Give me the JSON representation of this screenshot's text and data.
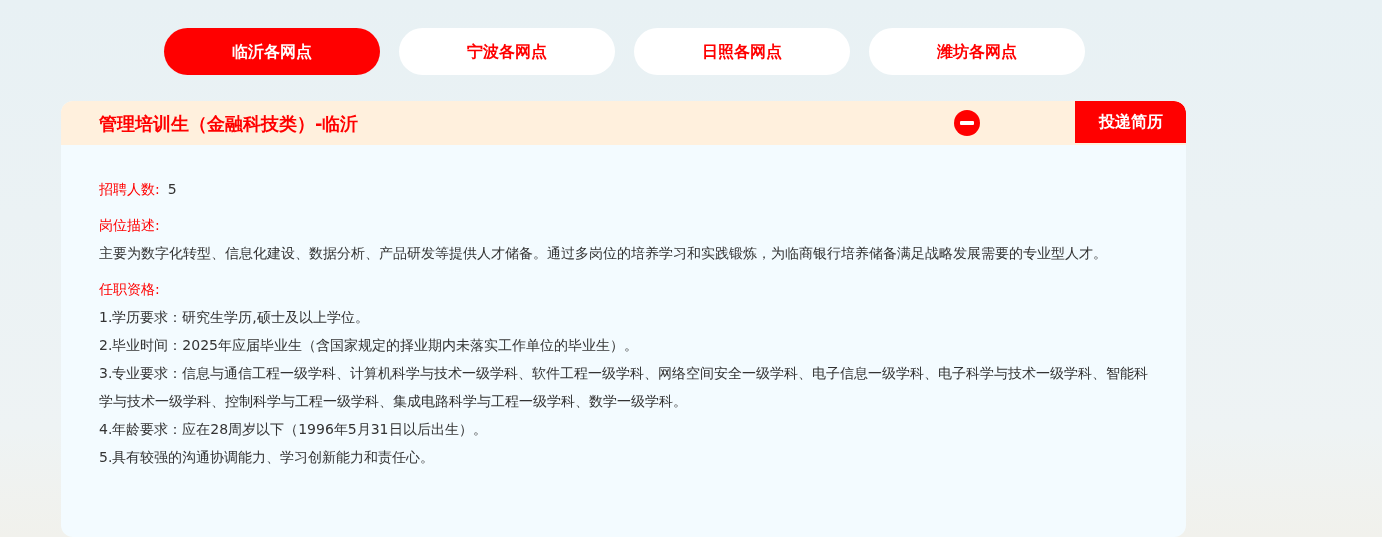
{
  "tabs": [
    {
      "label": "临沂各网点",
      "selected": true
    },
    {
      "label": "宁波各网点",
      "selected": false
    },
    {
      "label": "日照各网点",
      "selected": false
    },
    {
      "label": "潍坊各网点",
      "selected": false
    }
  ],
  "job": {
    "title": "管理培训生（金融科技类）-临沂",
    "expanded": true,
    "apply_button": "投递简历",
    "headcount": {
      "label": "招聘人数:",
      "value": "5"
    },
    "sections": [
      {
        "label": "岗位描述:",
        "lines": [
          "主要为数字化转型、信息化建设、数据分析、产品研发等提供人才储备。通过多岗位的培养学习和实践锻炼，为临商银行培养储备满足战略发展需要的专业型人才。"
        ]
      },
      {
        "label": "任职资格:",
        "lines": [
          "1.学历要求：研究生学历,硕士及以上学位。",
          "2.毕业时间：2025年应届毕业生（含国家规定的择业期内未落实工作单位的毕业生）。",
          "3.专业要求：信息与通信工程一级学科、计算机科学与技术一级学科、软件工程一级学科、网络空间安全一级学科、电子信息一级学科、电子科学与技术一级学科、智能科学与技术一级学科、控制科学与工程一级学科、集成电路科学与工程一级学科、数学一级学科。",
          "4.年龄要求：应在28周岁以下（1996年5月31日以后出生）。",
          "5.具有较强的沟通协调能力、学习创新能力和责任心。"
        ]
      }
    ]
  }
}
